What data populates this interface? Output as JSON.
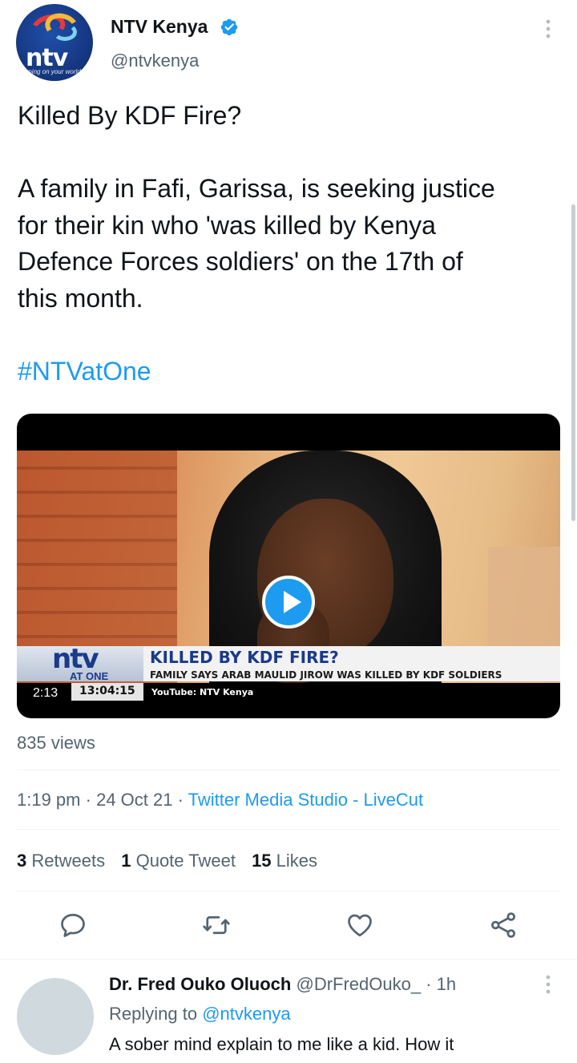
{
  "tweet": {
    "author": {
      "name": "NTV Kenya",
      "handle": "@ntvkenya",
      "avatar_logo": "ntv",
      "avatar_tagline": "turning on your world",
      "verified_icon": "verified-badge-icon"
    },
    "headline": "Killed By KDF Fire?",
    "body": "A family in Fafi, Garissa, is seeking justice\nfor their kin who 'was killed by Kenya\nDefence Forces soldiers' on the 17th of\nthis month.",
    "hashtag": "#NTVatOne",
    "video": {
      "duration": "2:13",
      "ticker_logo": "ntv",
      "ticker_logo_sub": "AT ONE",
      "ticker_headline": "KILLED BY KDF FIRE?",
      "ticker_subheadline": "FAMILY SAYS ARAB MAULID JIROW WAS KILLED BY KDF SOLDIERS",
      "ticker_time": "13:04:15",
      "ticker_source": "YouTube: NTV Kenya"
    },
    "views": "835 views",
    "time": "1:19 pm",
    "date": "24 Oct 21",
    "separator": "·",
    "source": "Twitter Media Studio - LiveCut",
    "stats": {
      "retweets_count": "3",
      "retweets_label": "Retweets",
      "quotes_count": "1",
      "quotes_label": "Quote Tweet",
      "likes_count": "15",
      "likes_label": "Likes"
    },
    "actions": [
      "reply-icon",
      "retweet-icon",
      "like-icon",
      "share-icon"
    ]
  },
  "reply": {
    "name": "Dr. Fred Ouko Oluoch",
    "handle": "@DrFredOuko_",
    "separator": "·",
    "time": "1h",
    "replying_to_label": "Replying to",
    "replying_to_handle": "@ntvkenya",
    "text": "A sober mind explain to me like a kid. How it"
  },
  "colors": {
    "accent": "#1d9bf0",
    "text_primary": "#0f1419",
    "text_secondary": "#536471",
    "divider": "#eff3f4"
  }
}
